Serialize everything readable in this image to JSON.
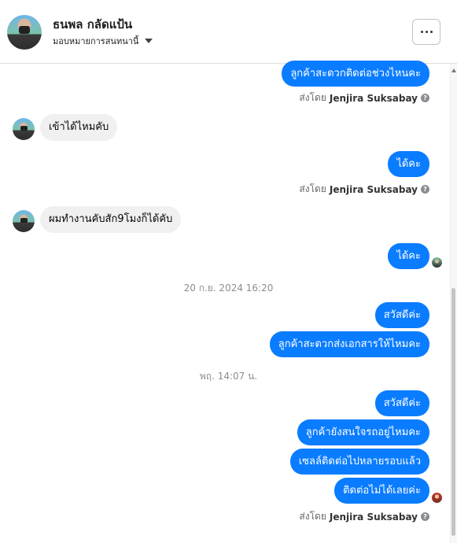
{
  "header": {
    "name": "ธนพล กลัดแป้น",
    "assign_label": "มอบหมายการสนทนานี้",
    "more_label": "more-options"
  },
  "messages": {
    "m1": "ลูกค้าสะดวกติดต่อช่วงไหนคะ",
    "m2": "เข้าได้ไหมคับ",
    "m3": "ได้คะ",
    "m4": "ผมทำงานคับสัก9โมงก็ได้คับ",
    "m5": "ได้คะ",
    "m6": "สวัสดีค่ะ",
    "m7": "ลูกค้าสะดวกส่งเอกสารให้ไหมคะ",
    "m8": "สวัสดีค่ะ",
    "m9": "ลูกค้ายังสนใจรถอยู่ไหมคะ",
    "m10": "เซลล์ติดต่อไปหลายรอบแล้ว",
    "m11": "ติดต่อไม่ได้เลยค่ะ"
  },
  "sent_by": {
    "prefix": "ส่งโดย",
    "agent": "Jenjira Suksabay",
    "info_glyph": "?"
  },
  "timestamps": {
    "t1": "20 ก.ย. 2024 16:20",
    "t2": "พฤ. 14:07 น."
  },
  "colors": {
    "outgoing_bubble": "#0a7cff",
    "incoming_bubble": "#f0f0f0"
  }
}
